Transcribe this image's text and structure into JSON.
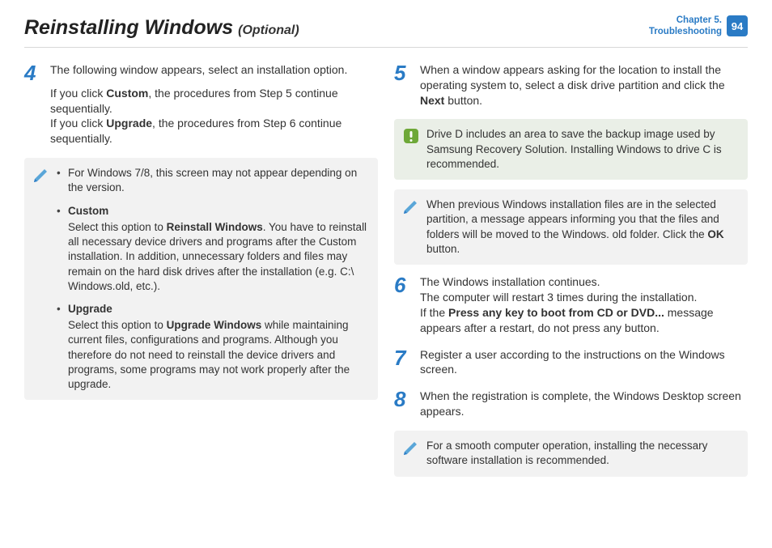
{
  "header": {
    "title": "Reinstalling Windows",
    "subtitle": "(Optional)",
    "chapter_line1": "Chapter 5.",
    "chapter_line2": "Troubleshooting",
    "page": "94"
  },
  "steps": {
    "s4": {
      "num": "4",
      "p1": "The following window appears, select an installation option.",
      "p2a": "If you click ",
      "p2b": "Custom",
      "p2c": ", the procedures from Step 5 continue sequentially.",
      "p3a": "If you click ",
      "p3b": "Upgrade",
      "p3c": ", the procedures from Step 6 continue sequentially."
    },
    "s5": {
      "num": "5",
      "p1a": "When a window appears asking for the location to install the operating system to, select a disk drive partition and click the ",
      "p1b": "Next",
      "p1c": " button."
    },
    "s6": {
      "num": "6",
      "p1": "The Windows installation continues.",
      "p2": "The computer will restart 3 times during the installation.",
      "p3a": "If the ",
      "p3b": "Press any key to boot from CD or DVD...",
      "p3c": " message appears after a restart, do not press any button."
    },
    "s7": {
      "num": "7",
      "p1": "Register a user according to the instructions on the Windows screen."
    },
    "s8": {
      "num": "8",
      "p1": "When the registration is complete, the Windows Desktop screen appears."
    }
  },
  "box4": {
    "li1": "For Windows 7/8, this screen may not appear depending on the version.",
    "li2_lead": "Custom",
    "li2_a": "Select this option to ",
    "li2_b": "Reinstall Windows",
    "li2_c": ". You have to reinstall all necessary device drivers and programs after the Custom installation. In addition, unnecessary folders and files may remain on the hard disk drives after the installation (e.g. C:\\ Windows.old, etc.).",
    "li3_lead": "Upgrade",
    "li3_a": "Select this option to ",
    "li3_b": "Upgrade Windows",
    "li3_c": " while maintaining current files, configurations and programs. Although you therefore do not need to reinstall the device drivers and programs, some programs may not work properly after the upgrade."
  },
  "box5a": "Drive D includes an area to save the backup image used by Samsung Recovery Solution. Installing Windows to drive C is recommended.",
  "box5b_a": "When previous Windows installation files are in the selected partition, a message appears informing you that the files and folders will be moved to the Windows. old folder. Click the ",
  "box5b_b": "OK",
  "box5b_c": " button.",
  "box8": "For a smooth computer operation, installing the necessary software installation is recommended."
}
